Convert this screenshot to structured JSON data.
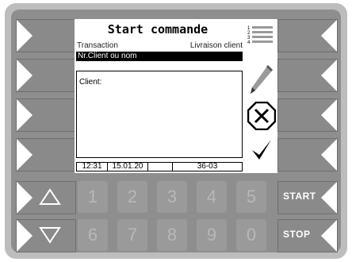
{
  "screen": {
    "title": "Start commande",
    "subtitle_left": "Transaction",
    "subtitle_right": "Livraison client",
    "highlight_bar": "Nr.Client ou nom",
    "textbox_label": "Client:",
    "status": {
      "time": "12:31",
      "date": "15.01.20",
      "empty": "",
      "code": "36-03"
    }
  },
  "icons": {
    "list": "numbered-list-icon",
    "pencil": "pencil-icon",
    "cancel": "cancel-icon",
    "confirm": "checkmark-icon"
  },
  "keypad": {
    "row1": [
      "1",
      "2",
      "3",
      "4",
      "5"
    ],
    "row2": [
      "6",
      "7",
      "8",
      "9",
      "0"
    ]
  },
  "right_buttons": {
    "start": "START",
    "stop": "STOP"
  },
  "colors": {
    "frame": "#8e8e8e",
    "bezel": "#bdbdbd",
    "button": "#8a8a8a",
    "screen_bg": "#ffffff"
  }
}
